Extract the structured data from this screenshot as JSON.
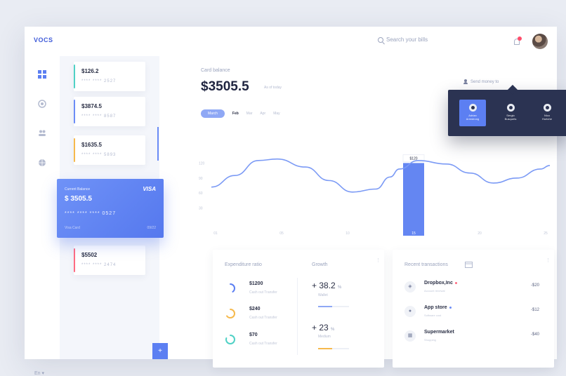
{
  "app": {
    "logo": "VOCS"
  },
  "header": {
    "search_placeholder": "Search your bills"
  },
  "sidebar": {
    "language": "En ▾",
    "items": [
      "dashboard-icon",
      "wallet-icon",
      "people-icon",
      "globe-icon"
    ]
  },
  "cards": [
    {
      "amount": "$126.2",
      "digits": "**** **** 2527",
      "accent": "#4fd1c5"
    },
    {
      "amount": "$3874.5",
      "digits": "**** **** 8587",
      "accent": "#6b8cf6"
    },
    {
      "amount": "$1635.5",
      "digits": "**** **** 5893",
      "accent": "#f6b94c"
    },
    {
      "amount": "$5502",
      "digits": "**** **** 2474",
      "accent": "#ff6b81"
    }
  ],
  "active_card": {
    "label": "Current Balance",
    "brand": "VISA",
    "amount": "$ 3505.5",
    "digits": "**** **** **** 0527",
    "holder": "Visa Card",
    "expiry": "09/22"
  },
  "balance": {
    "label": "Card balance",
    "amount": "$3505.5",
    "as_of": "As of today",
    "send_label": "Send money to"
  },
  "months": [
    {
      "label": "March",
      "state": "active"
    },
    {
      "label": "Feb",
      "state": "bold"
    },
    {
      "label": "Mar",
      "state": ""
    },
    {
      "label": "Apr",
      "state": ""
    },
    {
      "label": "May",
      "state": ""
    }
  ],
  "contacts": [
    {
      "name_line1": "Adrian",
      "name_line2": "Armstrong",
      "selected": true
    },
    {
      "name_line1": "Sergio",
      "name_line2": "Busquets",
      "selected": false
    },
    {
      "name_line1": "Nico",
      "name_line2": "Hortche",
      "selected": false
    }
  ],
  "chart_data": {
    "type": "area",
    "x_ticks": [
      "01",
      "05",
      "10",
      "15",
      "20",
      "25"
    ],
    "y_ticks": [
      120,
      90,
      60,
      30
    ],
    "ylim": [
      0,
      150
    ],
    "x": [
      0,
      5,
      10,
      14,
      20,
      25,
      30,
      35,
      38,
      40,
      44,
      50,
      55,
      60,
      65,
      70,
      72
    ],
    "values": [
      72,
      95,
      125,
      128,
      112,
      85,
      62,
      68,
      92,
      108,
      125,
      118,
      100,
      80,
      90,
      108,
      115
    ],
    "highlight_tick": "15",
    "highlight_value": 120,
    "highlight_label": "$120",
    "grid": false
  },
  "expenditure": {
    "title": "Expenditure ratio",
    "items": [
      {
        "amount": "$1200",
        "sub": "Cash out  Transfer",
        "color": "#5c7ff2",
        "fraction": 0.4
      },
      {
        "amount": "$240",
        "sub": "Cash out  Transfer",
        "color": "#f6b94c",
        "fraction": 0.65
      },
      {
        "amount": "$70",
        "sub": "Cash out  Transfer",
        "color": "#4fd1c5",
        "fraction": 0.8
      }
    ]
  },
  "growth": {
    "title": "Growth",
    "items": [
      {
        "value": "+ 38.2",
        "pct": "%",
        "name": "Wallet",
        "color": "#8fa8f5",
        "fraction": 0.45
      },
      {
        "value": "+ 23",
        "pct": "%",
        "name": "Medium",
        "color": "#f6b94c",
        "fraction": 0.45
      }
    ]
  },
  "transactions": {
    "title": "Recent transactions",
    "items": [
      {
        "icon": "dropbox-icon",
        "glyph": "◈",
        "name": "Dropbox,Inc",
        "category": "Account renewal",
        "amount": "-$20",
        "dot": "#ff6b81"
      },
      {
        "icon": "apple-icon",
        "glyph": "●",
        "name": "App store",
        "category": "Software cost",
        "amount": "-$12",
        "dot": "#6b8cf6"
      },
      {
        "icon": "basket-icon",
        "glyph": "▦",
        "name": "Supermarket",
        "category": "Shopping",
        "amount": "-$40",
        "dot": ""
      }
    ]
  }
}
